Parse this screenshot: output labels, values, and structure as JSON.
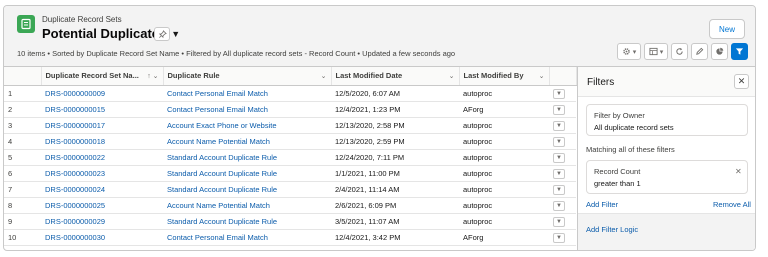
{
  "header": {
    "object_label": "Duplicate Record Sets",
    "list_view_name": "Potential Duplicates",
    "new_button": "New",
    "meta_line": "10 items • Sorted by Duplicate Record Set Name • Filtered by All duplicate record sets - Record Count • Updated a few seconds ago",
    "icons": [
      "list-settings-icon",
      "display-as-table-icon",
      "refresh-icon",
      "edit-icon",
      "chart-icon",
      "filter-icon"
    ]
  },
  "table": {
    "columns": [
      "Duplicate Record Set Na...",
      "Duplicate Rule",
      "Last Modified Date",
      "Last Modified By"
    ],
    "rows": [
      {
        "num": "1",
        "name": "DRS-0000000009",
        "rule": "Contact Personal Email Match",
        "date": "12/5/2020, 6:07 AM",
        "by": "autoproc"
      },
      {
        "num": "2",
        "name": "DRS-0000000015",
        "rule": "Contact Personal Email Match",
        "date": "12/4/2021, 1:23 PM",
        "by": "AForg"
      },
      {
        "num": "3",
        "name": "DRS-0000000017",
        "rule": "Account Exact Phone or Website",
        "date": "12/13/2020, 2:58 PM",
        "by": "autoproc"
      },
      {
        "num": "4",
        "name": "DRS-0000000018",
        "rule": "Account Name Potential Match",
        "date": "12/13/2020, 2:59 PM",
        "by": "autoproc"
      },
      {
        "num": "5",
        "name": "DRS-0000000022",
        "rule": "Standard Account Duplicate Rule",
        "date": "12/24/2020, 7:11 PM",
        "by": "autoproc"
      },
      {
        "num": "6",
        "name": "DRS-0000000023",
        "rule": "Standard Account Duplicate Rule",
        "date": "1/1/2021, 11:00 PM",
        "by": "autoproc"
      },
      {
        "num": "7",
        "name": "DRS-0000000024",
        "rule": "Standard Account Duplicate Rule",
        "date": "2/4/2021, 11:14 AM",
        "by": "autoproc"
      },
      {
        "num": "8",
        "name": "DRS-0000000025",
        "rule": "Account Name Potential Match",
        "date": "2/6/2021, 6:09 PM",
        "by": "autoproc"
      },
      {
        "num": "9",
        "name": "DRS-0000000029",
        "rule": "Standard Account Duplicate Rule",
        "date": "3/5/2021, 11:07 AM",
        "by": "autoproc"
      },
      {
        "num": "10",
        "name": "DRS-0000000030",
        "rule": "Contact Personal Email Match",
        "date": "12/4/2021, 3:42 PM",
        "by": "AForg"
      }
    ]
  },
  "filters": {
    "title": "Filters",
    "owner_label": "Filter by Owner",
    "owner_value": "All duplicate record sets",
    "matching_label": "Matching all of these filters",
    "filter_label": "Record Count",
    "filter_value": "greater than  1",
    "add_filter": "Add Filter",
    "remove_all": "Remove All",
    "add_filter_logic": "Add Filter Logic"
  },
  "colors": {
    "brand": "#0176d3",
    "link": "#0b5cab",
    "object_icon": "#3ba755"
  }
}
